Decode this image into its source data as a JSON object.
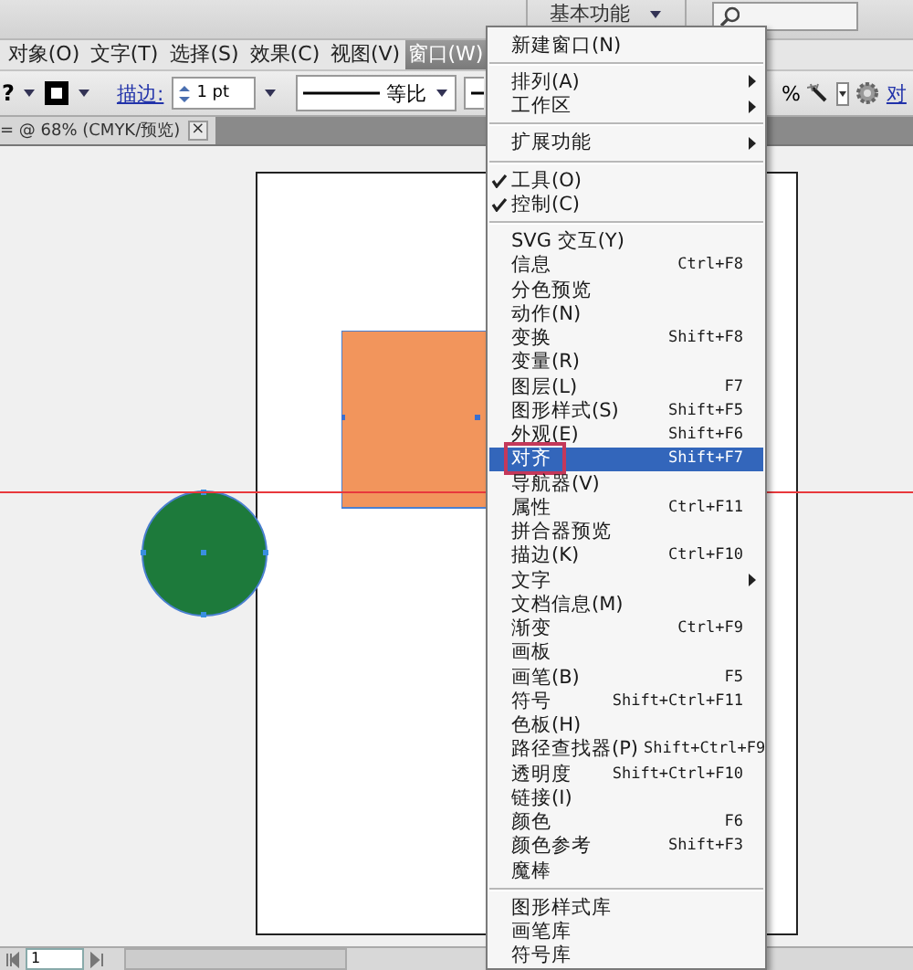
{
  "app_bar": {
    "workspace": "基本功能"
  },
  "menu_bar": [
    {
      "label": "对象(O)",
      "selected": false
    },
    {
      "label": "文字(T)",
      "selected": false
    },
    {
      "label": "选择(S)",
      "selected": false
    },
    {
      "label": "效果(C)",
      "selected": false
    },
    {
      "label": "视图(V)",
      "selected": false
    },
    {
      "label": "窗口(W)",
      "selected": true
    }
  ],
  "control_bar": {
    "fill": "?",
    "stroke_label": "描边:",
    "stroke_weight": "1 pt",
    "profile": "等比",
    "percent": "%",
    "align_link": "对"
  },
  "document_tab": {
    "title": "= @ 68% (CMYK/预览)",
    "close": "×"
  },
  "window_menu": {
    "items": [
      {
        "kind": "item",
        "label": "新建窗口(N)",
        "submenu": false,
        "checked": false,
        "selected": false,
        "outlined": false
      },
      {
        "kind": "separator"
      },
      {
        "kind": "item",
        "label": "排列(A)",
        "submenu": true,
        "checked": false,
        "selected": false,
        "outlined": false
      },
      {
        "kind": "item",
        "label": "工作区",
        "submenu": true,
        "checked": false,
        "selected": false,
        "outlined": false
      },
      {
        "kind": "separator"
      },
      {
        "kind": "item",
        "label": "扩展功能",
        "submenu": true,
        "checked": false,
        "selected": false,
        "outlined": false
      },
      {
        "kind": "separator"
      },
      {
        "kind": "item",
        "label": "工具(O)",
        "submenu": false,
        "checked": true,
        "selected": false,
        "outlined": false
      },
      {
        "kind": "item",
        "label": "控制(C)",
        "submenu": false,
        "checked": true,
        "selected": false,
        "outlined": false
      },
      {
        "kind": "separator"
      },
      {
        "kind": "item",
        "label": "SVG 交互(Y)",
        "submenu": false,
        "checked": false,
        "selected": false,
        "outlined": false
      },
      {
        "kind": "item",
        "label": "信息",
        "shortcut": "Ctrl+F8",
        "submenu": false,
        "checked": false,
        "selected": false,
        "outlined": false
      },
      {
        "kind": "item",
        "label": "分色预览",
        "submenu": false,
        "checked": false,
        "selected": false,
        "outlined": false
      },
      {
        "kind": "item",
        "label": "动作(N)",
        "submenu": false,
        "checked": false,
        "selected": false,
        "outlined": false
      },
      {
        "kind": "item",
        "label": "变换",
        "shortcut": "Shift+F8",
        "submenu": false,
        "checked": false,
        "selected": false,
        "outlined": false
      },
      {
        "kind": "item",
        "label": "变量(R)",
        "submenu": false,
        "checked": false,
        "selected": false,
        "outlined": false
      },
      {
        "kind": "item",
        "label": "图层(L)",
        "shortcut": "F7",
        "submenu": false,
        "checked": false,
        "selected": false,
        "outlined": false
      },
      {
        "kind": "item",
        "label": "图形样式(S)",
        "shortcut": "Shift+F5",
        "submenu": false,
        "checked": false,
        "selected": false,
        "outlined": false
      },
      {
        "kind": "item",
        "label": "外观(E)",
        "shortcut": "Shift+F6",
        "submenu": false,
        "checked": false,
        "selected": false,
        "outlined": false
      },
      {
        "kind": "item",
        "label": "对齐",
        "shortcut": "Shift+F7",
        "submenu": false,
        "checked": false,
        "selected": true,
        "outlined": true
      },
      {
        "kind": "item",
        "label": "导航器(V)",
        "submenu": false,
        "checked": false,
        "selected": false,
        "outlined": false
      },
      {
        "kind": "item",
        "label": "属性",
        "shortcut": "Ctrl+F11",
        "submenu": false,
        "checked": false,
        "selected": false,
        "outlined": false
      },
      {
        "kind": "item",
        "label": "拼合器预览",
        "submenu": false,
        "checked": false,
        "selected": false,
        "outlined": false
      },
      {
        "kind": "item",
        "label": "描边(K)",
        "shortcut": "Ctrl+F10",
        "submenu": false,
        "checked": false,
        "selected": false,
        "outlined": false
      },
      {
        "kind": "item",
        "label": "文字",
        "submenu": true,
        "checked": false,
        "selected": false,
        "outlined": false
      },
      {
        "kind": "item",
        "label": "文档信息(M)",
        "submenu": false,
        "checked": false,
        "selected": false,
        "outlined": false
      },
      {
        "kind": "item",
        "label": "渐变",
        "shortcut": "Ctrl+F9",
        "submenu": false,
        "checked": false,
        "selected": false,
        "outlined": false
      },
      {
        "kind": "item",
        "label": "画板",
        "submenu": false,
        "checked": false,
        "selected": false,
        "outlined": false
      },
      {
        "kind": "item",
        "label": "画笔(B)",
        "shortcut": "F5",
        "submenu": false,
        "checked": false,
        "selected": false,
        "outlined": false
      },
      {
        "kind": "item",
        "label": "符号",
        "shortcut": "Shift+Ctrl+F11",
        "submenu": false,
        "checked": false,
        "selected": false,
        "outlined": false
      },
      {
        "kind": "item",
        "label": "色板(H)",
        "submenu": false,
        "checked": false,
        "selected": false,
        "outlined": false
      },
      {
        "kind": "item",
        "label": "路径查找器(P)",
        "shortcut": "Shift+Ctrl+F9",
        "submenu": false,
        "checked": false,
        "selected": false,
        "outlined": false
      },
      {
        "kind": "item",
        "label": "透明度",
        "shortcut": "Shift+Ctrl+F10",
        "submenu": false,
        "checked": false,
        "selected": false,
        "outlined": false
      },
      {
        "kind": "item",
        "label": "链接(I)",
        "submenu": false,
        "checked": false,
        "selected": false,
        "outlined": false
      },
      {
        "kind": "item",
        "label": "颜色",
        "shortcut": "F6",
        "submenu": false,
        "checked": false,
        "selected": false,
        "outlined": false
      },
      {
        "kind": "item",
        "label": "颜色参考",
        "shortcut": "Shift+F3",
        "submenu": false,
        "checked": false,
        "selected": false,
        "outlined": false
      },
      {
        "kind": "item",
        "label": "魔棒",
        "submenu": false,
        "checked": false,
        "selected": false,
        "outlined": false
      },
      {
        "kind": "separator"
      },
      {
        "kind": "item",
        "label": "图形样式库",
        "submenu": false,
        "checked": false,
        "selected": false,
        "outlined": false
      },
      {
        "kind": "item",
        "label": "画笔库",
        "submenu": false,
        "checked": false,
        "selected": false,
        "outlined": false
      },
      {
        "kind": "item",
        "label": "符号库",
        "submenu": false,
        "checked": false,
        "selected": false,
        "outlined": false
      }
    ]
  },
  "status_bar": {
    "page": "1"
  }
}
